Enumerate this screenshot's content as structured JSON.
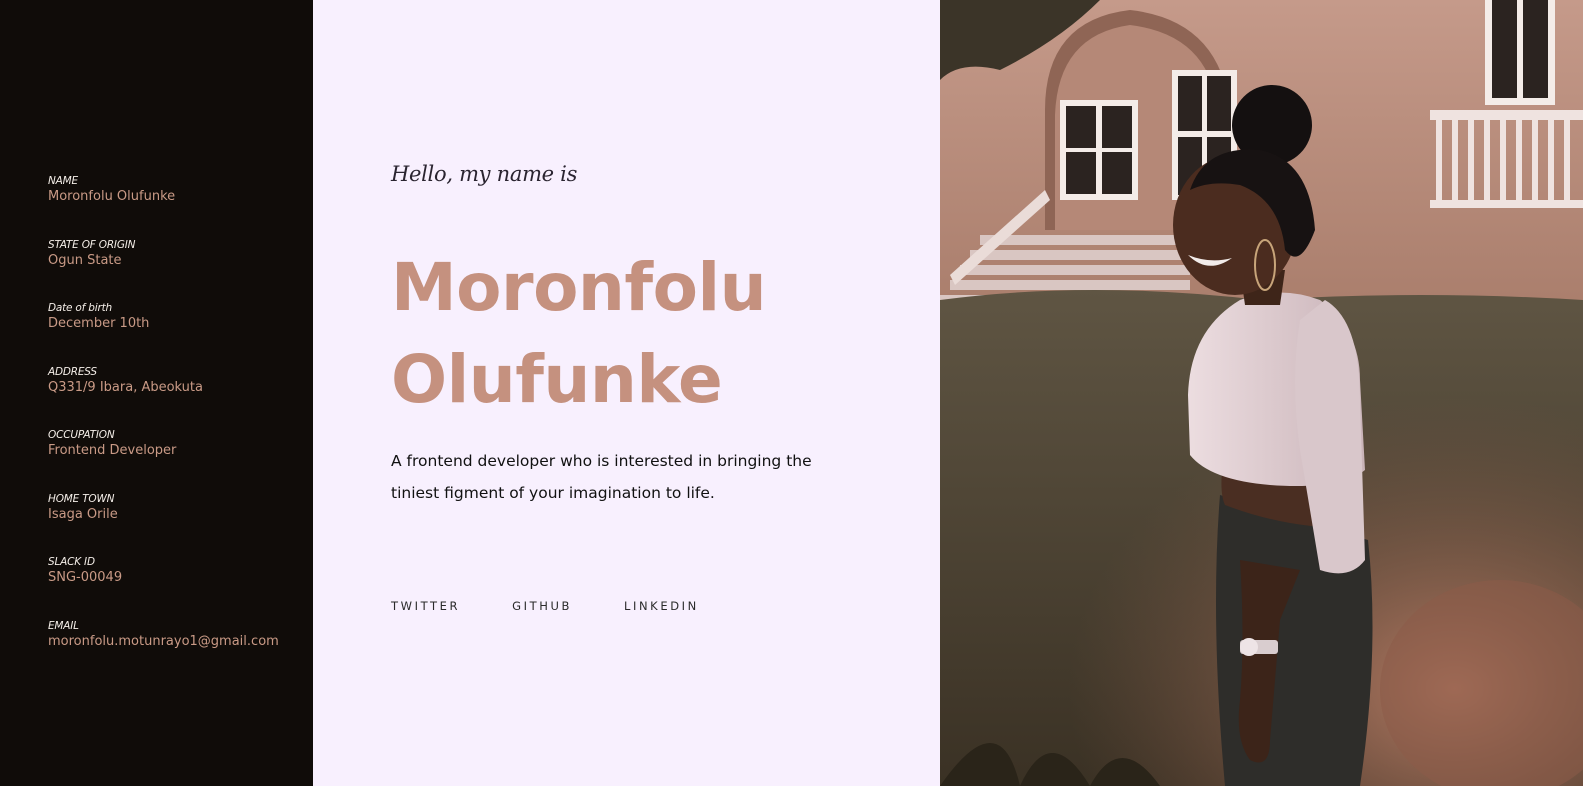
{
  "profile": {
    "items": [
      {
        "label": "NAME",
        "value": "Moronfolu Olufunke"
      },
      {
        "label": "STATE OF ORIGIN",
        "value": "Ogun State"
      },
      {
        "label": "Date of birth",
        "value": "December 10th"
      },
      {
        "label": "ADDRESS",
        "value": "Q331/9 Ibara, Abeokuta"
      },
      {
        "label": "OCCUPATION",
        "value": "Frontend Developer"
      },
      {
        "label": "HOME TOWN",
        "value": "Isaga Orile"
      },
      {
        "label": "SLACK ID",
        "value": "SNG-00049"
      },
      {
        "label": "EMAIL",
        "value": "moronfolu.motunrayo1@gmail.com"
      }
    ]
  },
  "hero": {
    "greeting": "Hello, my name is",
    "first_name": "Moronfolu",
    "last_name": "Olufunke",
    "bio": "A frontend developer who is interested in bringing the tiniest figment of your imagination to life."
  },
  "socials": [
    {
      "label": "TWITTER"
    },
    {
      "label": "GITHUB"
    },
    {
      "label": "LINKEDIN"
    }
  ],
  "colors": {
    "sidebar_bg": "#100c09",
    "accent": "#c5917f",
    "main_bg": "#f8f0fe"
  }
}
